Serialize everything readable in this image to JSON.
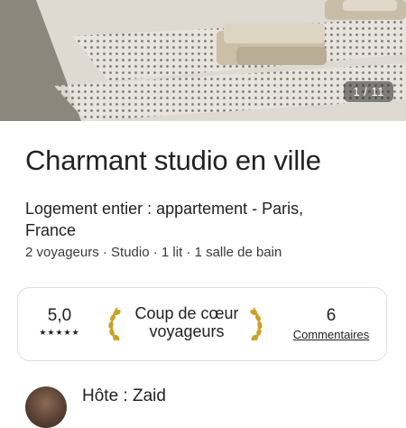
{
  "photo": {
    "counter": "1 / 11",
    "icon": "bed-photo"
  },
  "listing": {
    "title": "Charmant studio en ville",
    "subtitle": "Logement entier : appartement - Paris, France",
    "details": "2 voyageurs · Studio · 1 lit · 1 salle de bain"
  },
  "highlights": {
    "rating": "5,0",
    "stars": "★★★★★",
    "award": "Coup de cœur voyageurs",
    "reviews_count": "6",
    "reviews_label": "Commentaires",
    "laurel_color": "#c9a227"
  },
  "host": {
    "label": "Hôte : Zaid"
  }
}
